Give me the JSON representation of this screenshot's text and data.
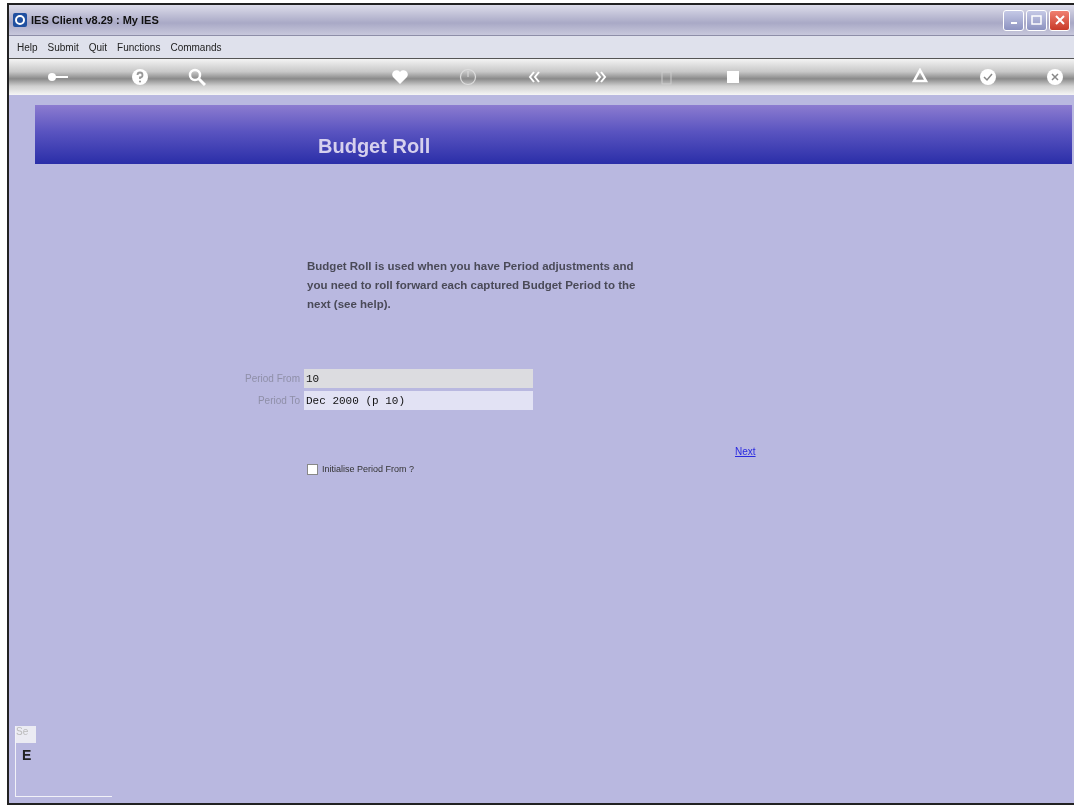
{
  "window": {
    "title": "IES Client v8.29 : My IES"
  },
  "menu": [
    "Help",
    "Submit",
    "Quit",
    "Functions",
    "Commands"
  ],
  "header": {
    "title": "Budget Roll"
  },
  "description": "Budget Roll is used when you have Period adjustments and you need to roll forward each captured Budget Period to the next (see help).",
  "fields": [
    {
      "label": "Period From",
      "value": "10",
      "focused": true
    },
    {
      "label": "Period To",
      "value": "Dec 2000 (p 10)",
      "focused": false
    }
  ],
  "checkbox": {
    "label": "Initialise Period From ?",
    "checked": false
  },
  "next_link": "Next",
  "side_panel": {
    "tab": "Se",
    "letter": "E"
  }
}
